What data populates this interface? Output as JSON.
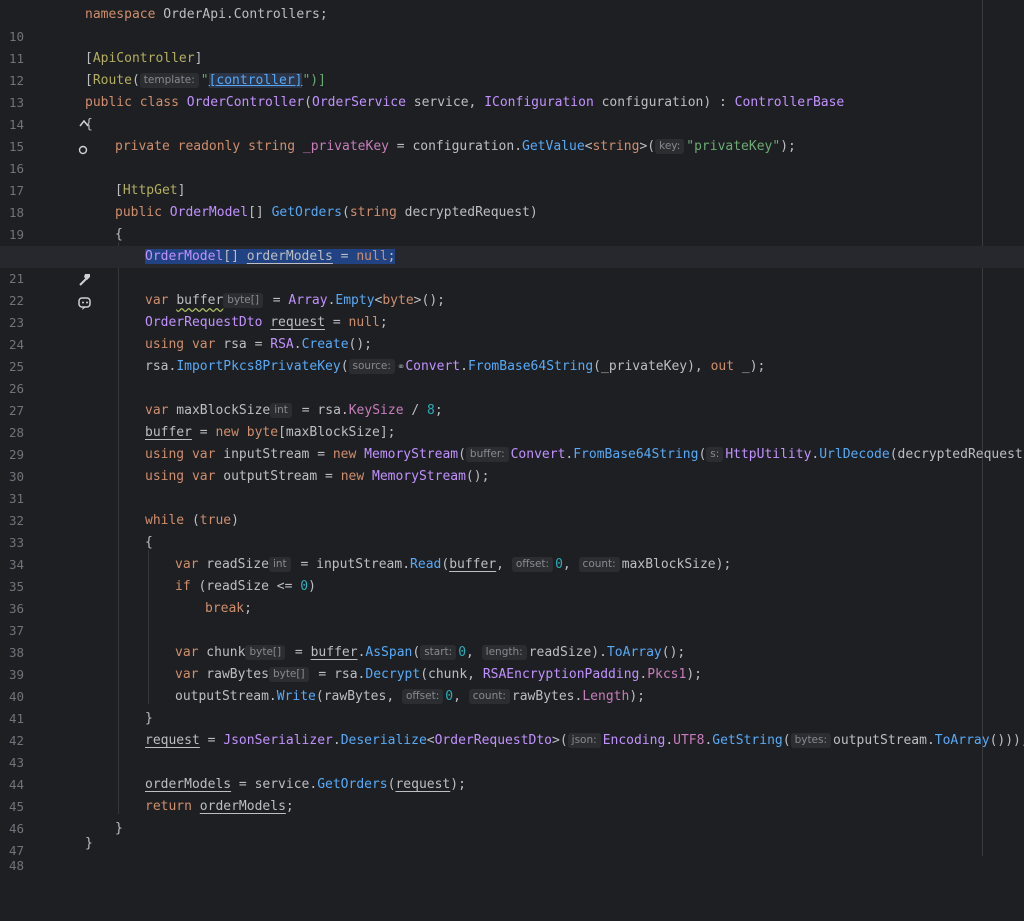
{
  "editor": {
    "lines": [
      {
        "n": "10"
      },
      {
        "n": "11"
      },
      {
        "n": "12"
      },
      {
        "n": "13"
      },
      {
        "n": "14"
      },
      {
        "n": "15"
      },
      {
        "n": "16"
      },
      {
        "n": "17"
      },
      {
        "n": "18"
      },
      {
        "n": "19"
      },
      {
        "n": "20"
      },
      {
        "n": "21"
      },
      {
        "n": "22"
      },
      {
        "n": "23"
      },
      {
        "n": "24"
      },
      {
        "n": "25"
      },
      {
        "n": "26"
      },
      {
        "n": "27"
      },
      {
        "n": "28"
      },
      {
        "n": "29"
      },
      {
        "n": "30"
      },
      {
        "n": "31"
      },
      {
        "n": "32"
      },
      {
        "n": "33"
      },
      {
        "n": "34"
      },
      {
        "n": "35"
      },
      {
        "n": "36"
      },
      {
        "n": "37"
      },
      {
        "n": "38"
      },
      {
        "n": "39"
      },
      {
        "n": "40"
      },
      {
        "n": "41"
      },
      {
        "n": "42"
      },
      {
        "n": "43"
      },
      {
        "n": "44"
      },
      {
        "n": "45"
      },
      {
        "n": "46"
      },
      {
        "n": "47"
      },
      {
        "n": "48"
      }
    ],
    "gutter_icons": {
      "line14": [
        "implemented-up-icon",
        "override-circle-icon"
      ],
      "line21": [
        "hammer-icon",
        "ai-assistant-icon"
      ]
    },
    "colors": {
      "background": "#1e1f22",
      "keyword": "#cf8e6d",
      "string": "#6aab73",
      "number": "#2aacb8",
      "class": "#c191ff",
      "method": "#56a8f5",
      "attribute": "#b3ae60",
      "field": "#c77dbb",
      "selection": "#214283"
    }
  },
  "t": {
    "l10": [
      "namespace",
      " OrderApi.Controllers;"
    ],
    "l12": [
      "[",
      "ApiController",
      "]"
    ],
    "l13": [
      "[",
      "Route",
      "(",
      "template:",
      "\"",
      "[controller]",
      "\")]"
    ],
    "l14": [
      "public",
      " ",
      "class",
      " ",
      "OrderController",
      "(",
      "OrderService",
      " service, ",
      "IConfiguration",
      " configuration) : ",
      "ControllerBase"
    ],
    "l15": [
      "{"
    ],
    "l16": [
      "private",
      " ",
      "readonly",
      " ",
      "string",
      " ",
      "_privateKey",
      " = configuration.",
      "GetValue",
      "<",
      "string",
      ">(",
      "key:",
      "\"privateKey\"",
      ");"
    ],
    "l18": [
      "[",
      "HttpGet",
      "]"
    ],
    "l19": [
      "public",
      " ",
      "OrderModel",
      "[] ",
      "GetOrders",
      "(",
      "string",
      " decryptedRequest)"
    ],
    "l20": [
      "{"
    ],
    "l21": [
      "OrderModel",
      "[] ",
      "orderModels",
      " = ",
      "null",
      ";"
    ],
    "l23": [
      "var",
      " ",
      "buffer",
      "byte[]",
      " = ",
      "Array",
      ".",
      "Empty",
      "<",
      "byte",
      ">();"
    ],
    "l24": [
      "OrderRequestDto",
      " ",
      "request",
      " = ",
      "null",
      ";"
    ],
    "l25": [
      "using",
      " ",
      "var",
      " rsa = ",
      "RSA",
      ".",
      "Create",
      "();"
    ],
    "l26": [
      "rsa.",
      "ImportPkcs8PrivateKey",
      "(",
      "source:",
      "Convert",
      ".",
      "FromBase64String",
      "(_privateKey), ",
      "out",
      " _);"
    ],
    "l28": [
      "var",
      " maxBlockSize",
      "int",
      " = rsa.",
      "KeySize",
      " / ",
      "8",
      ";"
    ],
    "l29": [
      "buffer",
      " = ",
      "new",
      " ",
      "byte",
      "[maxBlockSize];"
    ],
    "l30": [
      "using",
      " ",
      "var",
      " inputStream = ",
      "new",
      " ",
      "MemoryStream",
      "(",
      "buffer:",
      "Convert",
      ".",
      "FromBase64String",
      "(",
      "s:",
      "HttpUtility",
      ".",
      "UrlDecode",
      "(decryptedRequest)));"
    ],
    "l31": [
      "using",
      " ",
      "var",
      " outputStream = ",
      "new",
      " ",
      "MemoryStream",
      "();"
    ],
    "l33": [
      "while",
      " (",
      "true",
      ")"
    ],
    "l34": [
      "{"
    ],
    "l35": [
      "var",
      " readSize",
      "int",
      " = inputStream.",
      "Read",
      "(",
      "buffer",
      ", ",
      "offset:",
      "0",
      ", ",
      "count:",
      "maxBlockSize);"
    ],
    "l36": [
      "if",
      " (readSize <= ",
      "0",
      ")"
    ],
    "l37": [
      "break",
      ";"
    ],
    "l39": [
      "var",
      " chunk",
      "byte[]",
      " = ",
      "buffer",
      ".",
      "AsSpan",
      "(",
      "start:",
      "0",
      ", ",
      "length:",
      "readSize).",
      "ToArray",
      "();"
    ],
    "l40": [
      "var",
      " rawBytes",
      "byte[]",
      " = rsa.",
      "Decrypt",
      "(chunk, ",
      "RSAEncryptionPadding",
      ".",
      "Pkcs1",
      ");"
    ],
    "l41": [
      "outputStream.",
      "Write",
      "(rawBytes, ",
      "offset:",
      "0",
      ", ",
      "count:",
      "rawBytes.",
      "Length",
      ");"
    ],
    "l42": [
      "}"
    ],
    "l43": [
      "request",
      " = ",
      "JsonSerializer",
      ".",
      "Deserialize",
      "<",
      "OrderRequestDto",
      ">(",
      "json:",
      "Encoding",
      ".",
      "UTF8",
      ".",
      "GetString",
      "(",
      "bytes:",
      "outputStream.",
      "ToArray",
      "()));"
    ],
    "l45": [
      "orderModels",
      " = service.",
      "GetOrders",
      "(",
      "request",
      ");"
    ],
    "l46": [
      "return",
      " ",
      "orderModels",
      ";"
    ],
    "l47": [
      "}"
    ],
    "l48": [
      "}"
    ]
  }
}
